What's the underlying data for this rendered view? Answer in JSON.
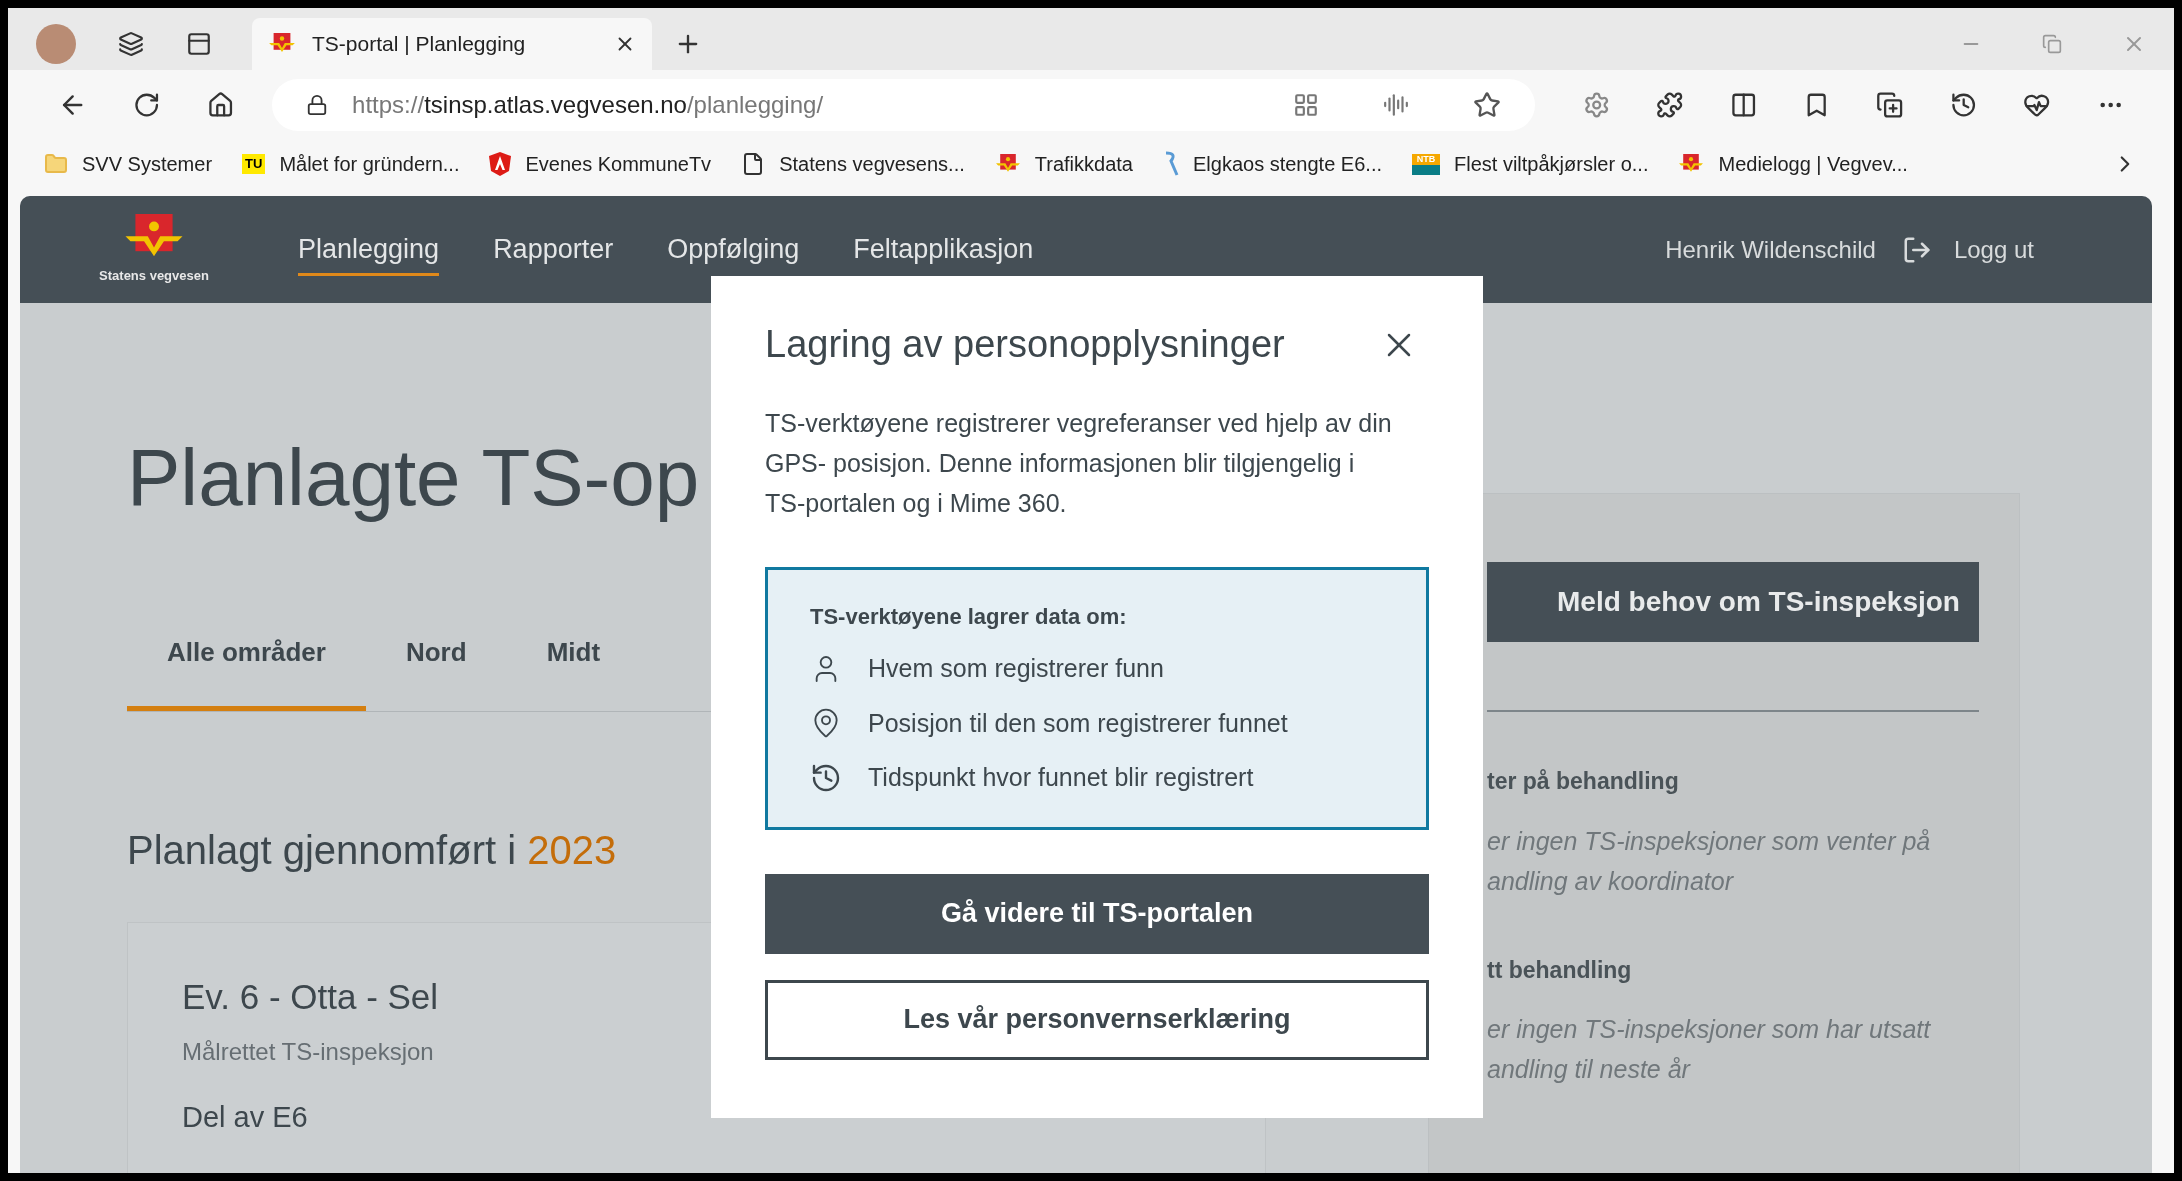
{
  "browser": {
    "tabs": [
      {
        "title": "TS-portal | Planlegging",
        "selected": true
      }
    ],
    "url": {
      "scheme": "https://",
      "host": "tsinsp.atlas.vegvesen.no",
      "path": "/planlegging/"
    },
    "bookmarks": [
      {
        "label": "SVV Systemer",
        "kind": "folder"
      },
      {
        "label": "Målet for gründern...",
        "kind": "badge",
        "badge": "TU"
      },
      {
        "label": "Evenes KommuneTv",
        "kind": "shield"
      },
      {
        "label": "Statens vegvesens...",
        "kind": "page"
      },
      {
        "label": "Trafikkdata",
        "kind": "svv"
      },
      {
        "label": "Elgkaos stengte E6...",
        "kind": "r"
      },
      {
        "label": "Flest viltpåkjørsler o...",
        "kind": "ntb",
        "badge": "NTB"
      },
      {
        "label": "Medielogg | Vegvev...",
        "kind": "svv"
      }
    ]
  },
  "site": {
    "logo_text": "Statens vegvesen",
    "nav": [
      {
        "label": "Planlegging",
        "selected": true
      },
      {
        "label": "Rapporter",
        "selected": false
      },
      {
        "label": "Oppfølging",
        "selected": false
      },
      {
        "label": "Feltapplikasjon",
        "selected": false
      }
    ],
    "user": "Henrik Wildenschild",
    "logout": "Logg ut"
  },
  "page": {
    "heading": "Planlagte TS-op",
    "filter_tabs": [
      {
        "label": "Alle områder",
        "selected": true
      },
      {
        "label": "Nord",
        "selected": false
      },
      {
        "label": "Midt",
        "selected": false
      }
    ],
    "subheading": {
      "text": "Planlagt gjennomført i",
      "year": "2023"
    },
    "card": {
      "title": "Ev. 6 - Otta - Sel",
      "type": "Målrettet TS-inspeksjon",
      "detail": "Del av E6"
    }
  },
  "side_panel": {
    "button": "Meld behov om TS-inspeksjon",
    "sections": [
      {
        "heading": "ter på behandling",
        "lines": [
          "er ingen TS-inspeksjoner som venter på",
          "andling av koordinator"
        ]
      },
      {
        "heading": "tt behandling",
        "lines": [
          "er ingen TS-inspeksjoner som har utsatt",
          "andling til neste år"
        ]
      }
    ]
  },
  "modal": {
    "title": "Lagring av personopplysninger",
    "intro": [
      "TS-verktøyene registrerer vegreferanser ved hjelp av din",
      "GPS- posisjon. Denne informasjonen blir tilgjengelig i",
      "TS-portalen og i Mime 360."
    ],
    "info_box": {
      "heading": "TS-verktøyene lagrer data om:",
      "items": [
        {
          "kind": "person",
          "text": "Hvem som registrerer funn"
        },
        {
          "kind": "pin",
          "text": "Posisjon til den som registrerer funnet"
        },
        {
          "kind": "history",
          "text": "Tidspunkt hvor funnet blir registrert"
        }
      ]
    },
    "buttons": [
      {
        "kind": "primary",
        "label": "Gå videre til TS-portalen"
      },
      {
        "kind": "secondary",
        "label": "Les vår personvernserklæring"
      }
    ]
  }
}
